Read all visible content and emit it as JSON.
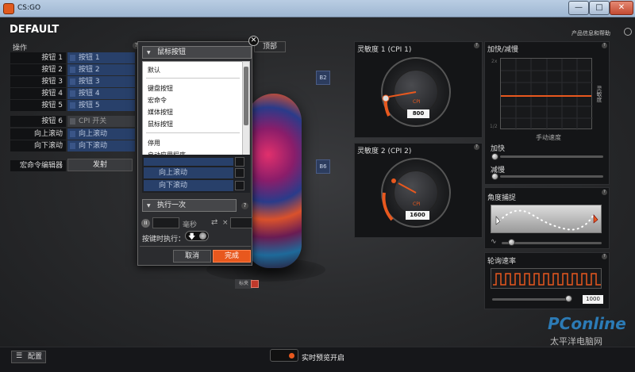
{
  "window": {
    "title": "CS:GO",
    "minimize": "—",
    "maximize": "□",
    "close": "✕"
  },
  "profile": {
    "title": "DEFAULT"
  },
  "header": {
    "product_info": "产品信息和帮助"
  },
  "ops": {
    "label": "操作",
    "help": "?",
    "rows": [
      {
        "label": "按钮 1",
        "value": "按钮 1"
      },
      {
        "label": "按钮 2",
        "value": "按钮 2"
      },
      {
        "label": "按钮 3",
        "value": "按钮 3"
      },
      {
        "label": "按钮 4",
        "value": "按钮 4"
      },
      {
        "label": "按钮 5",
        "value": "按钮 5"
      },
      {
        "label": "按钮 6",
        "value": "CPI 开关"
      },
      {
        "label": "向上滚动",
        "value": "向上滚动"
      },
      {
        "label": "向下滚动",
        "value": "向下滚动"
      }
    ],
    "macro_label": "宏命令编辑器",
    "fire_label": "发射"
  },
  "mouse": {
    "top_btn": "顶部",
    "b2": "B2",
    "b6": "B6",
    "scroll_label": "标夹"
  },
  "popup": {
    "close": "✕",
    "dropdown_value": "鼠标按钮",
    "dropdown_items": [
      "默认",
      "键盘按钮",
      "宏命令",
      "媒体按钮",
      "鼠标按钮",
      "停用",
      "启动应用程序"
    ],
    "list_items": [
      "向上滚动",
      "向下滚动"
    ],
    "exec_value": "执行一次",
    "exec_help": "?",
    "ms_label": "毫秒",
    "times_label": "×",
    "onpress_label": "按键时执行：",
    "onpress_arrow": "🡇",
    "cancel": "取消",
    "done": "完成"
  },
  "cpi1": {
    "title": "灵敏度 1 (CPI 1)",
    "help": "?",
    "cpi_label": "CPI",
    "value": "800"
  },
  "cpi2": {
    "title": "灵敏度 2 (CPI 2)",
    "help": "?",
    "cpi_label": "CPI",
    "value": "1600"
  },
  "accel": {
    "title": "加快/减慢",
    "help": "?",
    "y_label": "灵敏度",
    "x_label": "手动速度",
    "y_top": "2x",
    "y_bottom": "1/2",
    "accel_label": "加快",
    "decel_label": "减慢"
  },
  "angle": {
    "title": "角度捕捉",
    "help": "?"
  },
  "polling": {
    "title": "轮询速率",
    "help": "?",
    "value": "1000"
  },
  "bottom": {
    "config_label": "配置",
    "preview_label": "实时预览开启"
  },
  "watermark": {
    "brand": "PConline",
    "sub": "太平洋电脑网"
  },
  "colors": {
    "accent": "#e8581e",
    "button_blue": "#28406a"
  }
}
